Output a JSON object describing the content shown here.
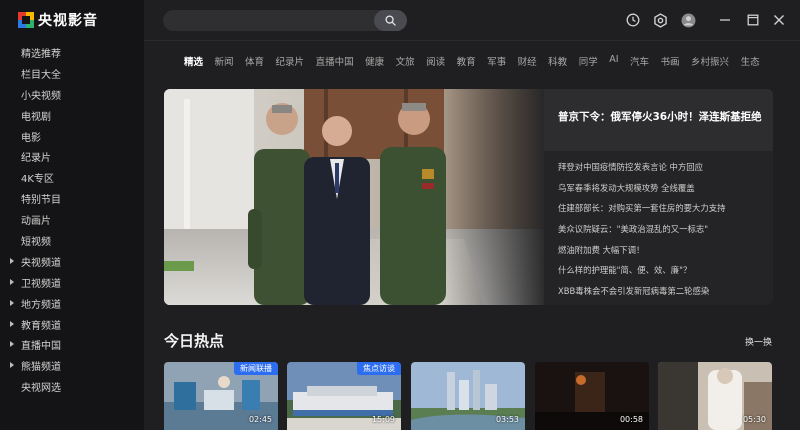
{
  "app": {
    "name": "央视影音"
  },
  "sidebar": {
    "items": [
      {
        "label": "精选推荐",
        "expandable": false
      },
      {
        "label": "栏目大全",
        "expandable": false
      },
      {
        "label": "小央视频",
        "expandable": false
      },
      {
        "label": "电视剧",
        "expandable": false
      },
      {
        "label": "电影",
        "expandable": false
      },
      {
        "label": "纪录片",
        "expandable": false
      },
      {
        "label": "4K专区",
        "expandable": false
      },
      {
        "label": "特别节目",
        "expandable": false
      },
      {
        "label": "动画片",
        "expandable": false
      },
      {
        "label": "短视频",
        "expandable": false
      },
      {
        "label": "央视频道",
        "expandable": true
      },
      {
        "label": "卫视频道",
        "expandable": true
      },
      {
        "label": "地方频道",
        "expandable": true
      },
      {
        "label": "教育频道",
        "expandable": true
      },
      {
        "label": "直播中国",
        "expandable": true
      },
      {
        "label": "熊猫频道",
        "expandable": true
      },
      {
        "label": "央视网选",
        "expandable": false
      }
    ]
  },
  "header": {
    "search": {
      "value": "",
      "placeholder": ""
    },
    "icons": [
      "search-icon",
      "history-icon",
      "settings-icon",
      "avatar-icon",
      "minimize-icon",
      "maximize-icon",
      "close-icon"
    ]
  },
  "tabs": [
    {
      "label": "精选",
      "active": true
    },
    {
      "label": "新闻"
    },
    {
      "label": "体育"
    },
    {
      "label": "纪录片"
    },
    {
      "label": "直播中国"
    },
    {
      "label": "健康"
    },
    {
      "label": "文旅"
    },
    {
      "label": "阅读"
    },
    {
      "label": "教育"
    },
    {
      "label": "军事"
    },
    {
      "label": "财经"
    },
    {
      "label": "科教"
    },
    {
      "label": "同学"
    },
    {
      "label": "AI"
    },
    {
      "label": "汽车"
    },
    {
      "label": "书画"
    },
    {
      "label": "乡村振兴"
    },
    {
      "label": "生态"
    }
  ],
  "hero": {
    "headline": "普京下令：俄军停火36小时！泽连斯基拒绝",
    "list": [
      "拜登对中国疫情防控发表言论 中方回应",
      "乌军春季将发动大规模攻势 全线覆盖",
      "住建部部长：对购买第一套住房的要大力支持",
      "美众议院疑云：\"美政治混乱的又一标志\"",
      "燃油附加费 大幅下调！",
      "什么样的护理能\"简、便、效、廉\"？",
      "XBB毒株会不会引发新冠病毒第二轮感染"
    ]
  },
  "hot": {
    "title": "今日热点",
    "refresh_label": "换一换",
    "cards": [
      {
        "badge": "新闻联播",
        "duration": "02:45"
      },
      {
        "badge": "焦点访谈",
        "duration": "15:09"
      },
      {
        "badge": "",
        "duration": "03:53"
      },
      {
        "badge": "",
        "duration": "00:58"
      },
      {
        "badge": "",
        "duration": "05:30"
      }
    ]
  },
  "colors": {
    "accent": "#2d6ef0",
    "sidebar_bg": "#141416",
    "main_bg": "#1f1f21"
  }
}
